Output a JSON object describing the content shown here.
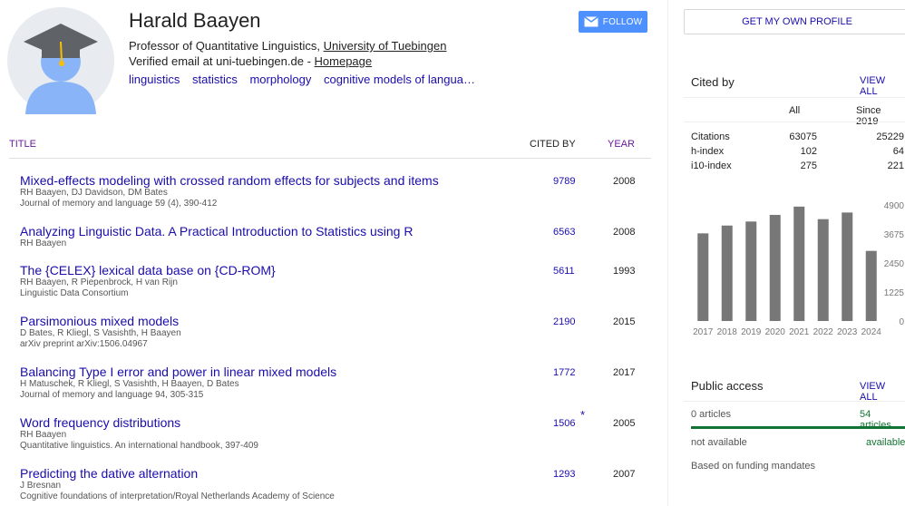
{
  "profile": {
    "name": "Harald Baayen",
    "affiliation_prefix": "Professor of Quantitative Linguistics, ",
    "affiliation_link": "University of Tuebingen",
    "email_prefix": "Verified email at uni-tuebingen.de - ",
    "homepage": "Homepage",
    "interests": [
      "linguistics",
      "statistics",
      "morphology",
      "cognitive models of langua…"
    ],
    "follow_label": "FOLLOW"
  },
  "table": {
    "col_title": "TITLE",
    "col_cited": "CITED BY",
    "col_year": "YEAR"
  },
  "articles": [
    {
      "title": "Mixed-effects modeling with crossed random effects for subjects and items",
      "authors": "RH Baayen, DJ Davidson, DM Bates",
      "venue": "Journal of memory and language 59 (4), 390-412",
      "cited": "9789",
      "year": "2008"
    },
    {
      "title": "Analyzing Linguistic Data. A Practical Introduction to Statistics using R",
      "authors": "RH Baayen",
      "venue": "",
      "cited": "6563",
      "year": "2008"
    },
    {
      "title": "The {CELEX} lexical data base on {CD-ROM}",
      "authors": "RH Baayen, R Piepenbrock, H van Rijn",
      "venue": "Linguistic Data Consortium",
      "cited": "5611",
      "year": "1993"
    },
    {
      "title": "Parsimonious mixed models",
      "authors": "D Bates, R Kliegl, S Vasishth, H Baayen",
      "venue": "arXiv preprint arXiv:1506.04967",
      "cited": "2190",
      "year": "2015"
    },
    {
      "title": "Balancing Type I error and power in linear mixed models",
      "authors": "H Matuschek, R Kliegl, S Vasishth, H Baayen, D Bates",
      "venue": "Journal of memory and language 94, 305-315",
      "cited": "1772",
      "year": "2017"
    },
    {
      "title": "Word frequency distributions",
      "authors": "RH Baayen",
      "venue": "Quantitative linguistics. An international handbook, 397-409",
      "cited": "1506",
      "star": "*",
      "year": "2005"
    },
    {
      "title": "Predicting the dative alternation",
      "authors": "J Bresnan",
      "venue": "Cognitive foundations of interpretation/Royal Netherlands Academy of Science",
      "cited": "1293",
      "year": "2007"
    }
  ],
  "sidebar": {
    "get_profile": "GET MY OWN PROFILE",
    "cited_by": "Cited by",
    "view_all": "VIEW ALL",
    "col_all": "All",
    "col_since": "Since 2019",
    "metrics": [
      {
        "label": "Citations",
        "all": "63075",
        "since": "25229"
      },
      {
        "label": "h-index",
        "all": "102",
        "since": "64"
      },
      {
        "label": "i10-index",
        "all": "275",
        "since": "221"
      }
    ],
    "public_access": "Public access",
    "pa_view_all": "VIEW ALL",
    "pa_zero": "0 articles",
    "pa_count": "54 articles",
    "not_available": "not available",
    "available": "available",
    "based_on": "Based on funding mandates"
  },
  "colors": {
    "bar": "#777777",
    "link": "#1a0dab",
    "follow_bg": "#4d90fe",
    "available_green": "#137333"
  },
  "chart_data": {
    "type": "bar",
    "categories": [
      "2017",
      "2018",
      "2019",
      "2020",
      "2021",
      "2022",
      "2023",
      "2024"
    ],
    "values": [
      3700,
      4030,
      4200,
      4480,
      4830,
      4300,
      4580,
      2960
    ],
    "y_ticks": [
      "0",
      "1225",
      "2450",
      "3675",
      "4900"
    ],
    "ylim": [
      0,
      4900
    ],
    "grid": false
  }
}
